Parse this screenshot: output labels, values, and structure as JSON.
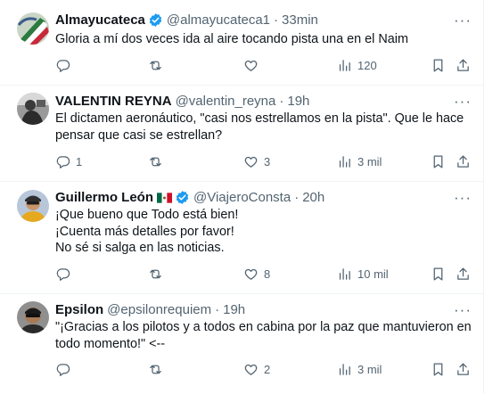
{
  "tweets": [
    {
      "name": "Almayucateca",
      "verified": true,
      "handle": "@almayucateca1",
      "time": "33min",
      "lines": [
        "Gloria a mí dos veces ida al aire tocando pista una en el Naim"
      ],
      "replies": "",
      "retweets": "",
      "likes": "",
      "views": "120"
    },
    {
      "name": "VALENTIN REYNA",
      "verified": false,
      "handle": "@valentin_reyna",
      "time": "19h",
      "lines": [
        "El dictamen aeronáutico, \"casi nos estrellamos en la pista\". Que le hace",
        "pensar que casi se estrellan?"
      ],
      "replies": "1",
      "retweets": "",
      "likes": "3",
      "views": "3 mil"
    },
    {
      "name": "Guillermo León",
      "verified": true,
      "handle": "@ViajeroConsta",
      "time": "20h",
      "lines": [
        "¡Que bueno que Todo está bien!",
        "¡Cuenta más detalles por favor!",
        "No sé si salga en las noticias."
      ],
      "replies": "",
      "retweets": "",
      "likes": "8",
      "views": "10 mil"
    },
    {
      "name": "Epsilon",
      "verified": false,
      "handle": "@epsilonrequiem",
      "time": "19h",
      "lines": [
        "\"¡Gracias a los pilotos y a todos en cabina por la paz que mantuvieron en",
        "todo momento!\" <--"
      ],
      "replies": "",
      "retweets": "",
      "likes": "2",
      "views": "3 mil"
    }
  ],
  "glyphs": {
    "more": "···",
    "dot": "·"
  },
  "colors": {
    "verified": "#1d9bf0",
    "muted": "#536471",
    "text": "#0f1419",
    "border": "#eff3f4"
  },
  "icons": [
    "reply-icon",
    "retweet-icon",
    "like-icon",
    "views-icon",
    "bookmark-icon",
    "share-icon",
    "verified-badge-icon",
    "mexico-flag-icon"
  ]
}
